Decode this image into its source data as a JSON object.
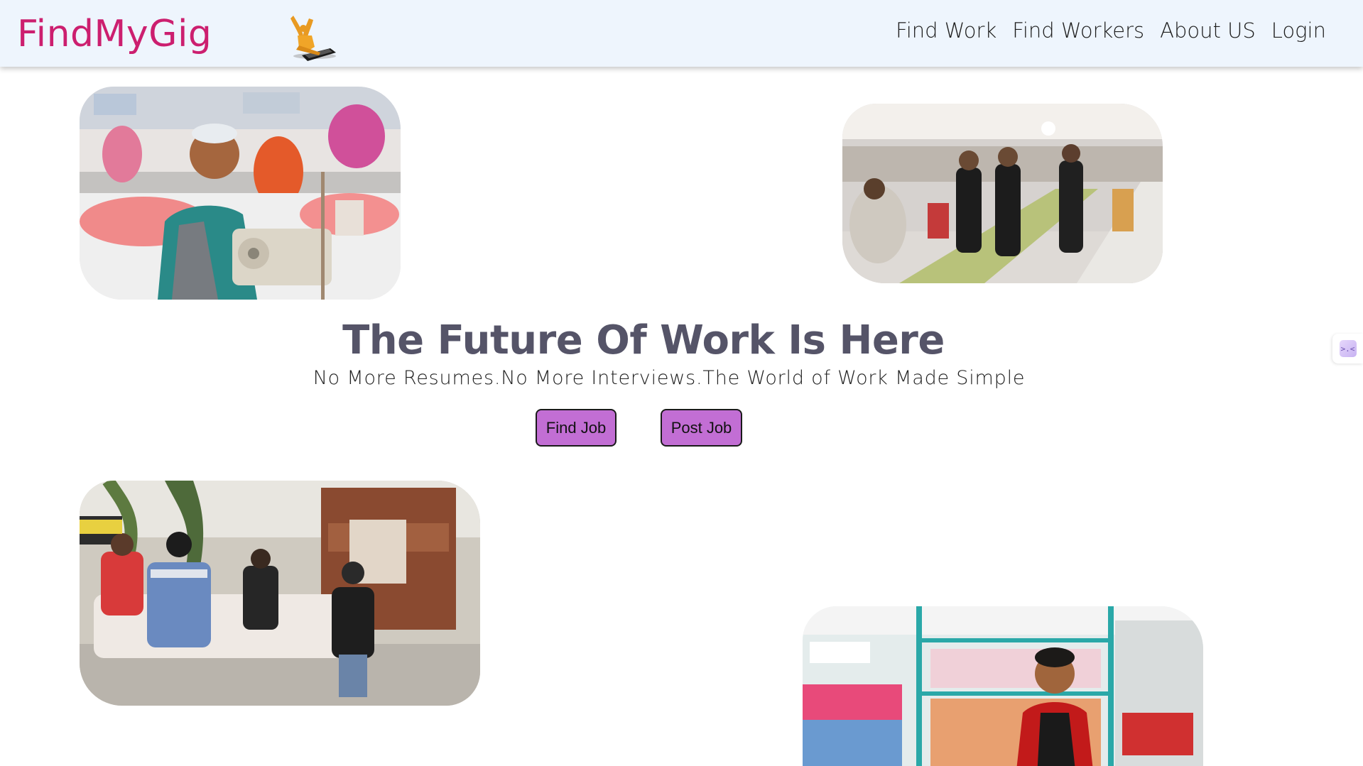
{
  "brand": {
    "name": "FindMyGig",
    "color": "#cc1f6f",
    "logo_icon": "person-laptop-logo-icon"
  },
  "nav": {
    "items": [
      {
        "label": "Find Work"
      },
      {
        "label": "Find Workers"
      },
      {
        "label": "About US"
      },
      {
        "label": "Login"
      }
    ]
  },
  "hero": {
    "title": "The Future Of Work Is Here",
    "subtitle": "No More Resumes.No More Interviews.The World of Work Made Simple",
    "buttons": {
      "find_job": "Find Job",
      "post_job": "Post Job"
    },
    "button_color": "#c26ed4"
  },
  "photos": [
    {
      "name": "garment-factory-worker-photo"
    },
    {
      "name": "catering-servers-photo"
    },
    {
      "name": "movers-loading-truck-photo"
    },
    {
      "name": "shopkeeper-store-photo"
    }
  ],
  "side_widget": {
    "icon": "extension-icon",
    "glyph": ">.<"
  }
}
